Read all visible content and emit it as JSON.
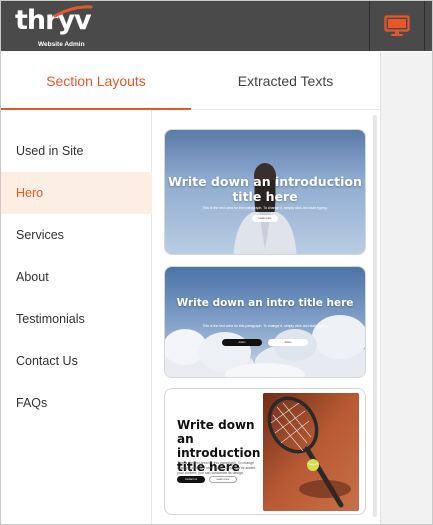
{
  "app": {
    "logo_text": "thryv",
    "logo_subtitle": "Website Admin"
  },
  "header": {
    "preview_icon": "monitor-icon",
    "accent_color": "#e8572a"
  },
  "tabs": [
    {
      "label": "Section Layouts",
      "active": true
    },
    {
      "label": "Extracted Texts",
      "active": false
    }
  ],
  "sidebar": {
    "items": [
      {
        "label": "Used in Site",
        "active": false
      },
      {
        "label": "Hero",
        "active": true
      },
      {
        "label": "Services",
        "active": false
      },
      {
        "label": "About",
        "active": false
      },
      {
        "label": "Testimonials",
        "active": false
      },
      {
        "label": "Contact Us",
        "active": false
      },
      {
        "label": "FAQs",
        "active": false
      }
    ]
  },
  "layouts": [
    {
      "title": "Write down an introduction title here",
      "subtitle": "This is the text area for this paragraph. To change it, simply click and start typing.",
      "buttons": [
        "Learn more"
      ]
    },
    {
      "title": "Write down an intro title here",
      "subtitle": "This is the text area for this paragraph. To change it, simply click and start typing.",
      "buttons": [
        "Action",
        "Action"
      ]
    },
    {
      "title": "Write down an introduction title here",
      "subtitle": "This is the text area for this paragraph. To change it, simply click and start typing. Once you've added your content, you can customize its design.",
      "buttons": [
        "Contact us",
        "Learn more"
      ]
    }
  ]
}
